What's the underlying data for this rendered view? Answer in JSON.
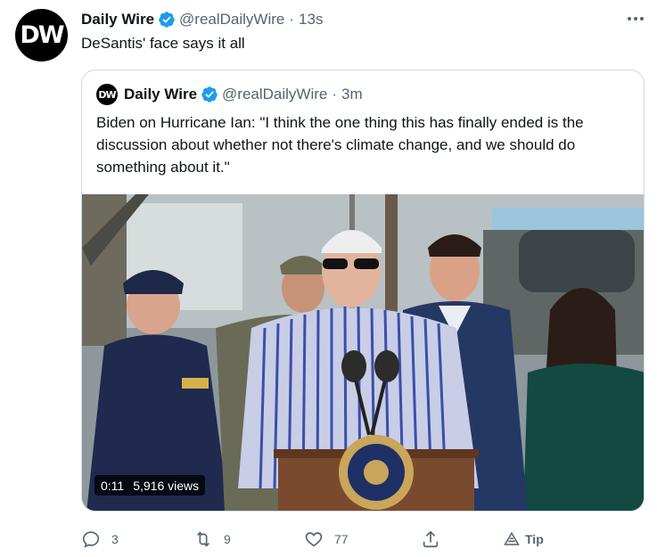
{
  "tweet": {
    "avatar_text": "DW",
    "author_name": "Daily Wire",
    "handle": "@realDailyWire",
    "separator": "·",
    "time": "13s",
    "text": "DeSantis' face says it all"
  },
  "quote": {
    "avatar_text": "DW",
    "author_name": "Daily Wire",
    "handle": "@realDailyWire",
    "separator": "·",
    "time": "3m",
    "text": "Biden on Hurricane Ian: \"I think the one thing this has finally ended is the discussion about whether not there's climate change, and we should do something about it.\"",
    "video": {
      "duration": "0:11",
      "views": "5,916 views"
    }
  },
  "actions": {
    "reply_count": "3",
    "retweet_count": "9",
    "like_count": "77",
    "tip_label": "Tip"
  },
  "icons": {
    "verified": "verified-badge-icon",
    "more": "more-dots-icon",
    "reply": "reply-icon",
    "retweet": "retweet-icon",
    "like": "heart-icon",
    "share": "share-icon",
    "tip": "tip-icon"
  },
  "colors": {
    "verified_blue": "#1d9bf0",
    "secondary_text": "#536471",
    "border": "#cfd9de"
  }
}
